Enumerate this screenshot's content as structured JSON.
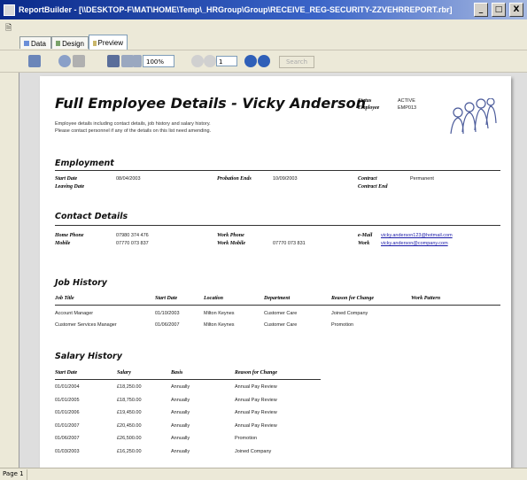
{
  "window": {
    "title": "ReportBuilder - [\\\\DESKTOP-F\\MAT\\HOME\\Temp\\_HRGroup\\Group\\RECEIVE_REG-SECURITY-ZZVEHRREPORT.rbr]",
    "min": "_",
    "restore": "□",
    "close": "X"
  },
  "tabs": [
    {
      "label": "Data"
    },
    {
      "label": "Design"
    },
    {
      "label": "Preview"
    }
  ],
  "toolbar": {
    "zoom": "100%",
    "page": "1",
    "find_label": "Search"
  },
  "status": {
    "page": "Page 1"
  },
  "report": {
    "title": "Full Employee Details -   Vicky Anderson",
    "intro_line1": "Employee details including contact details, job history and salary history.",
    "intro_line2": "Please contact personnel if any of the details on this list need amending.",
    "status_label": "Status",
    "status_value": "ACTIVE",
    "employee_label": "Employee",
    "employee_value": "EMP013",
    "employment": {
      "heading": "Employment",
      "start_label": "Start Date",
      "start_value": "08/04/2003",
      "probation_label": "Probation Ends",
      "probation_value": "10/09/2003",
      "contract_label": "Contract",
      "contract_value": "Permanent",
      "leaving_label": "Leaving Date",
      "contract_end_label": "Contract End"
    },
    "contact": {
      "heading": "Contact Details",
      "home_label": "Home Phone",
      "home_value": "07980 374 476",
      "mobile_label": "Mobile",
      "mobile_value": "07770 073 837",
      "work_phone_label": "Work Phone",
      "work_mobile_label": "Work Mobile",
      "work_mobile_value": "07770 073 831",
      "email_label": "e-Mail",
      "email_value": "vicky.anderson123@hotmail.com",
      "work_label": "Work",
      "work_value": "vicky.anderson@company.com"
    },
    "job_history": {
      "heading": "Job History",
      "columns": [
        "Job Title",
        "Start Date",
        "Location",
        "Department",
        "Reason for Change",
        "Work Pattern"
      ],
      "rows": [
        [
          "Account Manager",
          "01/10/2003",
          "Milton Keynes",
          "Customer Care",
          "Joined Company",
          ""
        ],
        [
          "Customer Services Manager",
          "01/06/2007",
          "Milton Keynes",
          "Customer Care",
          "Promotion",
          ""
        ]
      ]
    },
    "salary_history": {
      "heading": "Salary History",
      "columns": [
        "Start Date",
        "Salary",
        "Basis",
        "Reason for Change"
      ],
      "rows": [
        [
          "01/01/2004",
          "£18,250.00",
          "Annually",
          "Annual Pay Review"
        ],
        [
          "01/01/2005",
          "£18,750.00",
          "Annually",
          "Annual Pay Review"
        ],
        [
          "01/01/2006",
          "£19,450.00",
          "Annually",
          "Annual Pay Review"
        ],
        [
          "01/01/2007",
          "£20,450.00",
          "Annually",
          "Annual Pay Review"
        ],
        [
          "01/06/2007",
          "£26,500.00",
          "Annually",
          "Promotion"
        ],
        [
          "01/03/2003",
          "£16,250.00",
          "Annually",
          "Joined Company"
        ]
      ]
    }
  }
}
